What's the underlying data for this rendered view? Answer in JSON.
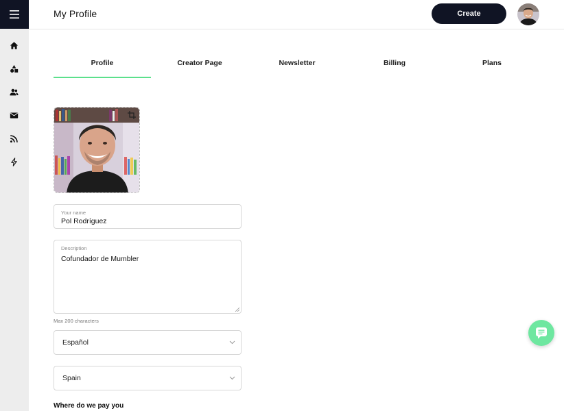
{
  "app": {
    "accent": "#5ce08c",
    "dark": "#101424"
  },
  "header": {
    "title": "My Profile",
    "create_label": "Create"
  },
  "sidebar": {
    "items": [
      {
        "icon": "home-icon"
      },
      {
        "icon": "shapes-icon"
      },
      {
        "icon": "users-icon"
      },
      {
        "icon": "mail-icon"
      },
      {
        "icon": "rss-icon"
      },
      {
        "icon": "bolt-icon"
      }
    ]
  },
  "tabs": [
    {
      "label": "Profile",
      "active": true
    },
    {
      "label": "Creator Page",
      "active": false
    },
    {
      "label": "Newsletter",
      "active": false
    },
    {
      "label": "Billing",
      "active": false
    },
    {
      "label": "Plans",
      "active": false
    }
  ],
  "form": {
    "name_label": "Your name",
    "name_value": "Pol Rodríguez",
    "description_label": "Description",
    "description_value": "Cofundador de Mumbler",
    "description_hint": "Max 200 characters",
    "language_value": "Español",
    "country_value": "Spain",
    "payout_heading": "Where do we pay you"
  }
}
